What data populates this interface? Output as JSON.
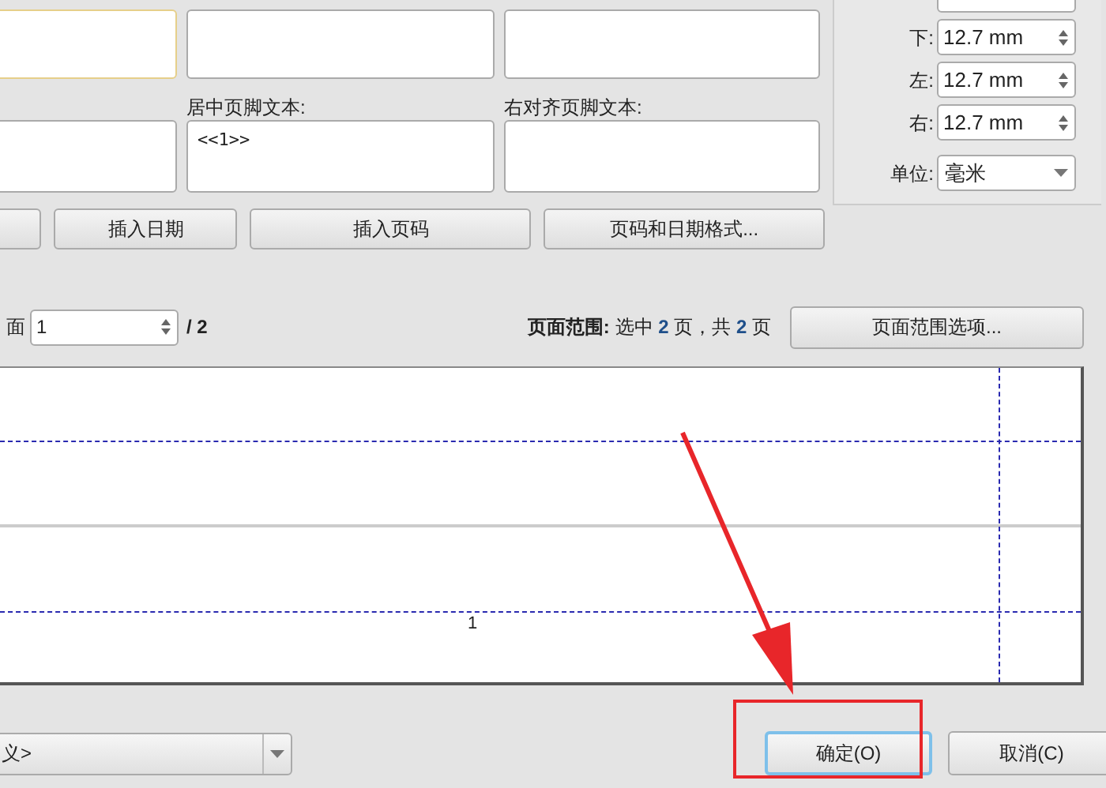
{
  "footer_fields": [
    {
      "label": "居中页脚文本:",
      "value": "<<1>>"
    },
    {
      "label": "右对齐页脚文本:"
    }
  ],
  "insert_buttons": [
    "插入日期",
    "插入页码",
    "页码和日期格式..."
  ],
  "margins": [
    {
      "label": "下:",
      "value": "12.7 mm"
    },
    {
      "label": "左:",
      "value": "12.7 mm"
    },
    {
      "label": "右:",
      "value": "12.7 mm"
    }
  ],
  "unit": {
    "label": "单位:",
    "value": "毫米"
  },
  "page_nav": {
    "label": "面",
    "value": "1",
    "total": "/ 2"
  },
  "page_range": {
    "label": "页面范围:",
    "selected_prefix": "选中",
    "selected": "2",
    "middle": "页，共",
    "total": "2",
    "suffix": "页",
    "button": "页面范围选项..."
  },
  "preview": {
    "page_number": "1"
  },
  "preset": {
    "value": "义>"
  },
  "buttons": [
    {
      "label": "确定(O)",
      "highlighted": true
    },
    {
      "label": "取消(C)",
      "highlighted": false
    }
  ]
}
